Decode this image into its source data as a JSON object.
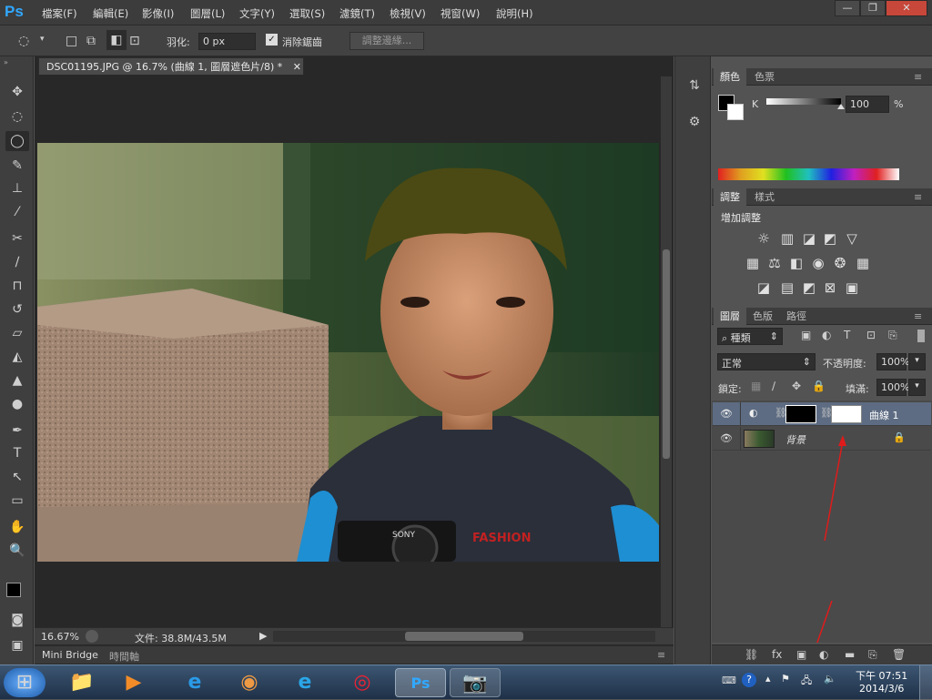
{
  "app": {
    "logo": "Ps"
  },
  "menu": {
    "items": [
      "檔案(F)",
      "編輯(E)",
      "影像(I)",
      "圖層(L)",
      "文字(Y)",
      "選取(S)",
      "濾鏡(T)",
      "檢視(V)",
      "視窗(W)",
      "說明(H)"
    ]
  },
  "window_buttons": {
    "minimize": "—",
    "restore": "❐",
    "close": "✕"
  },
  "options": {
    "feather_label": "羽化:",
    "feather_value": "0 px",
    "antialias_label": "消除鋸齒",
    "antialias_checked": true,
    "refine_edge_label": "調整邊緣..."
  },
  "document": {
    "tab_title": "DSC01195.JPG @ 16.7% (曲線 1, 圖層遮色片/8) *",
    "zoom": "16.67%",
    "doc_size": "文件: 38.8M/43.5M",
    "photo_text": "FASHION",
    "camera_brand": "SONY"
  },
  "mini_bridge": {
    "tabs": [
      "Mini Bridge",
      "時間軸"
    ]
  },
  "color_panel": {
    "tabs": [
      "顏色",
      "色票"
    ],
    "channel_label": "K",
    "value": "100",
    "unit": "%",
    "slider_level": 1.0
  },
  "adjustments_panel": {
    "tabs": [
      "調整",
      "樣式"
    ],
    "heading": "增加調整",
    "icons": [
      [
        "brightness-icon",
        "levels-icon",
        "curves-icon",
        "exposure-icon",
        "vibrance-icon"
      ],
      [
        "hue-icon",
        "color-balance-icon",
        "bw-icon",
        "photo-filter-icon",
        "channel-mixer-icon",
        "color-lookup-icon"
      ],
      [
        "invert-icon",
        "posterize-icon",
        "threshold-icon",
        "gradient-map-icon",
        "selective-color-icon"
      ]
    ]
  },
  "layers_panel": {
    "tabs": [
      "圖層",
      "色版",
      "路徑"
    ],
    "filter_kind": "種類",
    "blend_mode": "正常",
    "opacity_label": "不透明度:",
    "opacity_value": "100%",
    "lock_label": "鎖定:",
    "fill_label": "填滿:",
    "fill_value": "100%",
    "layers": [
      {
        "name": "曲線 1",
        "visible": true,
        "selected": true
      },
      {
        "name": "背景",
        "visible": true,
        "selected": false,
        "locked": true
      }
    ]
  },
  "taskbar": {
    "time": "下午 07:51",
    "date": "2014/3/6",
    "apps": [
      "windows-start-icon",
      "file-explorer-icon",
      "media-player-icon",
      "ie-icon",
      "color-wheel-icon",
      "ie-alt-icon",
      "chrome-icon",
      "photoshop-icon",
      "camera-icon"
    ]
  },
  "colors": {
    "accent": "#31a8ff",
    "selection": "#5d6c82",
    "annotation": "#e01b1b"
  }
}
